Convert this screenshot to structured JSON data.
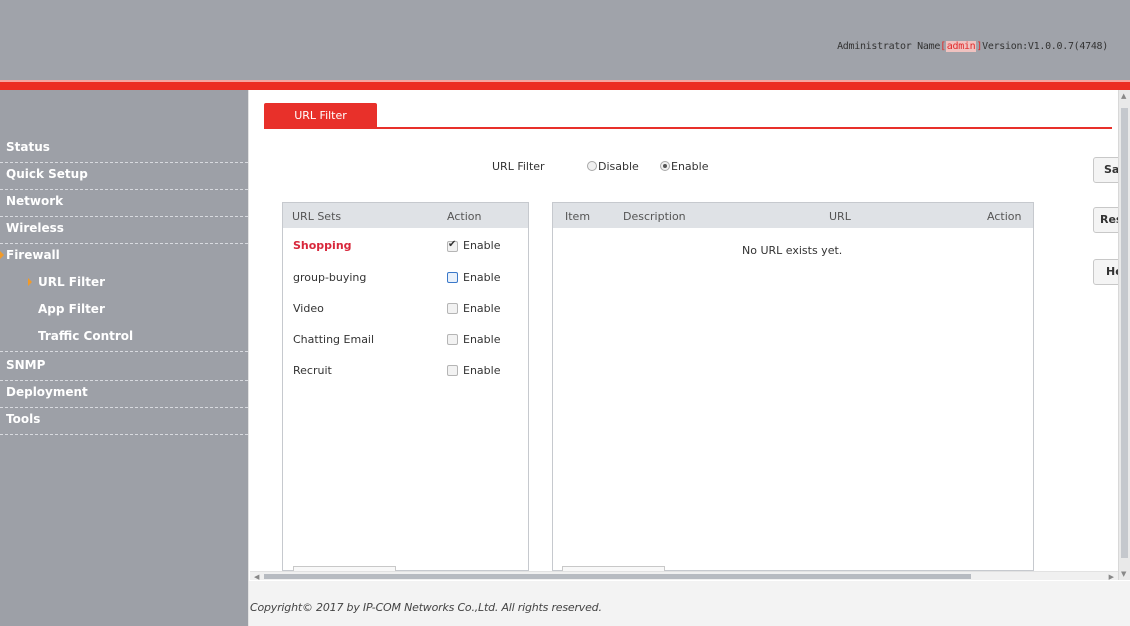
{
  "header": {
    "admin_prefix": "Administrator Name",
    "open_bracket": "[",
    "admin_name": "admin",
    "close_bracket": "]",
    "version": "Version:V1.0.0.7(4748)"
  },
  "sidebar": {
    "items": [
      {
        "label": "Status"
      },
      {
        "label": "Quick Setup"
      },
      {
        "label": "Network"
      },
      {
        "label": "Wireless"
      },
      {
        "label": "Firewall"
      },
      {
        "label": "URL Filter"
      },
      {
        "label": "App Filter"
      },
      {
        "label": "Traffic Control"
      },
      {
        "label": "SNMP"
      },
      {
        "label": "Deployment"
      },
      {
        "label": "Tools"
      }
    ]
  },
  "tab": {
    "label": "URL Filter"
  },
  "url_filter": {
    "label": "URL Filter",
    "disable_label": "Disable",
    "enable_label": "Enable",
    "selected": "Enable"
  },
  "side_buttons": {
    "save": "Save",
    "restore": "Restore",
    "help": "Help"
  },
  "url_sets": {
    "headers": {
      "name": "URL Sets",
      "action": "Action"
    },
    "rows": [
      {
        "name": "Shopping",
        "enable_label": "Enable",
        "checked": true
      },
      {
        "name": "group-buying",
        "enable_label": "Enable",
        "checked": false
      },
      {
        "name": "Video",
        "enable_label": "Enable",
        "checked": false
      },
      {
        "name": "Chatting Email",
        "enable_label": "Enable",
        "checked": false
      },
      {
        "name": "Recruit",
        "enable_label": "Enable",
        "checked": false
      }
    ]
  },
  "url_table": {
    "headers": {
      "item": "Item",
      "description": "Description",
      "url": "URL",
      "action": "Action"
    },
    "empty_message": "No URL exists yet."
  },
  "footer": {
    "copyright": "Copyright© 2017 by IP-COM Networks Co.,Ltd. All rights reserved."
  },
  "colors": {
    "accent": "#e8302a",
    "sidebar": "#9da0a7",
    "topbar": "#a0a3aa",
    "active_item": "#d8273b"
  }
}
